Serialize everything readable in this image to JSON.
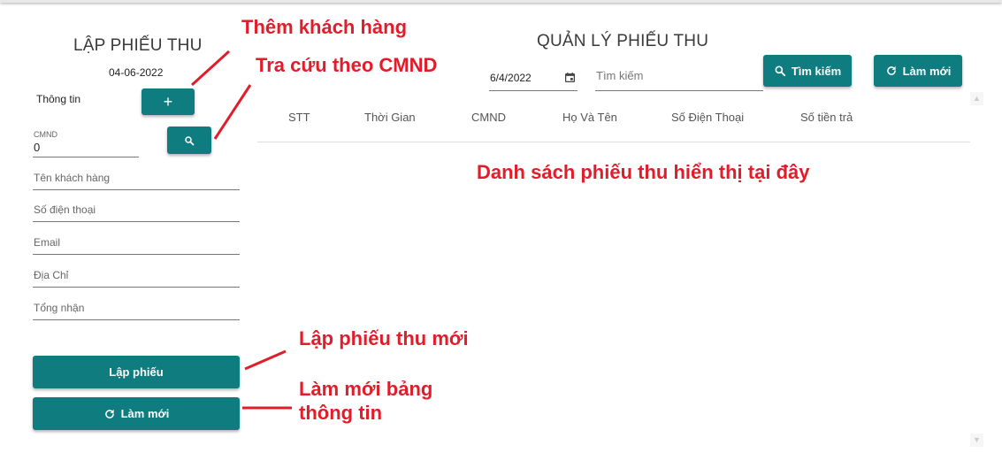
{
  "left_panel": {
    "title": "LẬP PHIẾU THU",
    "date": "04-06-2022",
    "info_label": "Thông tin",
    "add_button_glyph": "+",
    "cmnd_label": "CMND",
    "cmnd_value": "0",
    "fields": {
      "customer_name": "Tên khách hàng",
      "phone": "Số điện thoại",
      "email": "Email",
      "address": "Địa Chỉ",
      "total": "Tổng nhận"
    },
    "create_button": "Lập phiếu",
    "refresh_button": "Làm mới"
  },
  "right_panel": {
    "title": "QUẢN LÝ PHIẾU THU",
    "date_value": "6/4/2022",
    "search_placeholder": "Tìm kiếm",
    "search_button": "Tìm kiếm",
    "refresh_button": "Làm mới",
    "columns": [
      "STT",
      "Thời Gian",
      "CMND",
      "Họ Và Tên",
      "Số Điện Thoại",
      "Số tiền trả"
    ]
  },
  "annotations": {
    "add_customer": "Thêm khách hàng",
    "lookup_cmnd": "Tra cứu theo CMND",
    "list_here": "Danh sách phiếu thu hiển thị tại đây",
    "new_receipt": "Lập phiếu thu mới",
    "refresh_info_line1": "Làm mới bảng",
    "refresh_info_line2": "thông tin"
  },
  "colors": {
    "accent": "#0f7c80",
    "annotation": "#e01e2b"
  },
  "icons": [
    "plus-icon",
    "search-icon",
    "calendar-icon",
    "refresh-icon",
    "scroll-up-icon",
    "scroll-down-icon"
  ]
}
